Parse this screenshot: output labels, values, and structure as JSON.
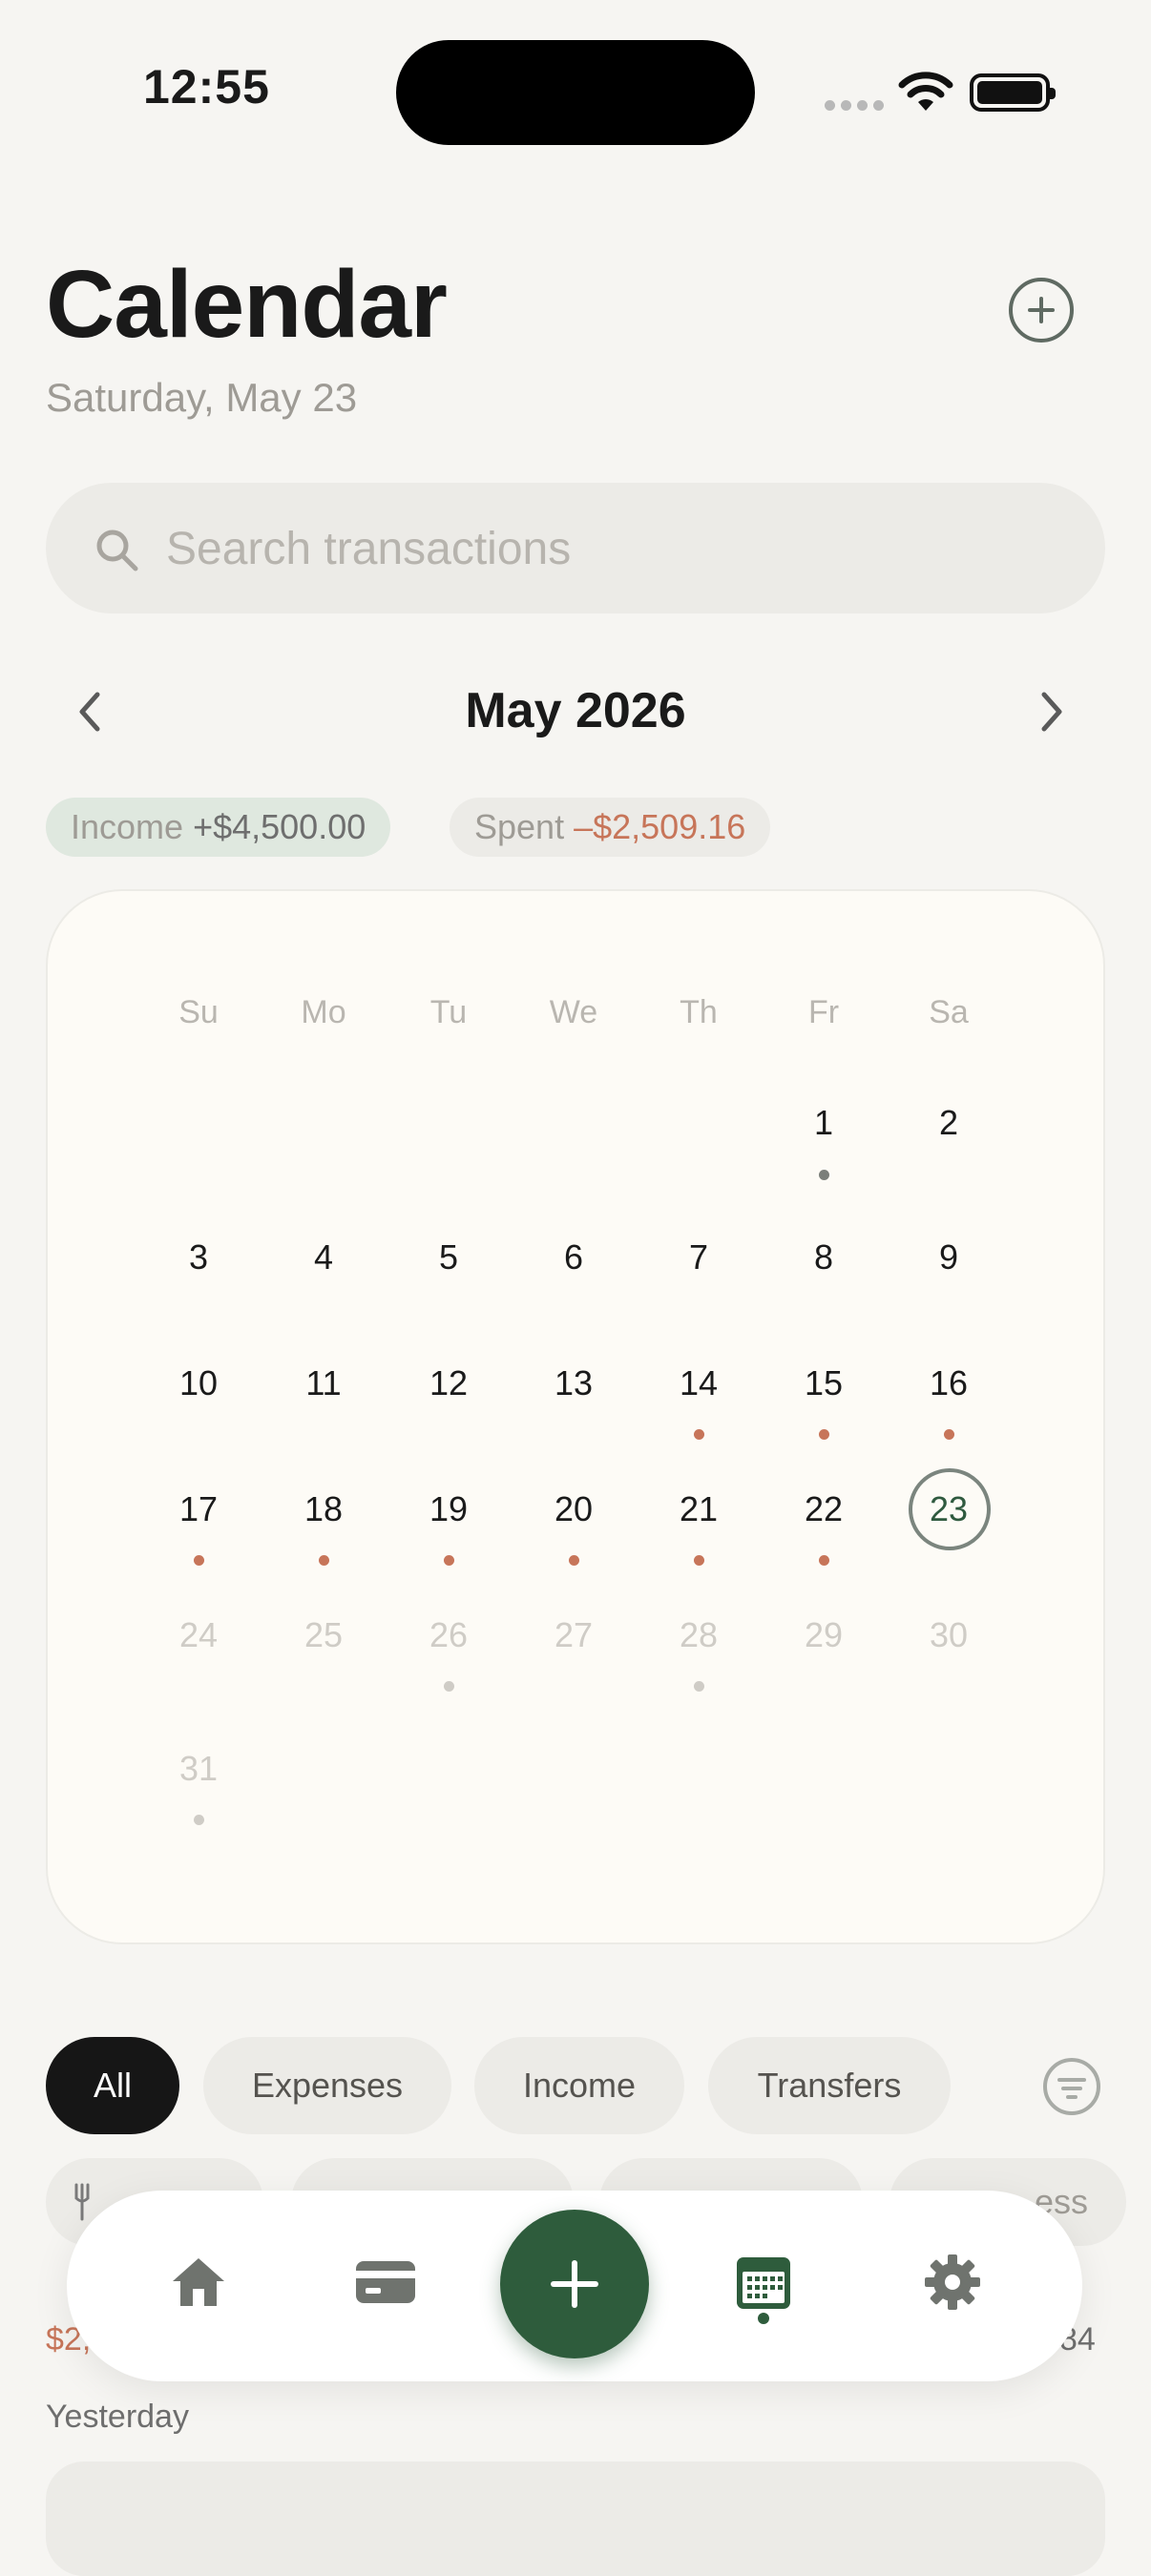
{
  "status_bar": {
    "time": "12:55"
  },
  "header": {
    "title": "Calendar",
    "subtitle": "Saturday, May 23"
  },
  "search": {
    "placeholder": "Search transactions"
  },
  "month_nav": {
    "label": "May 2026"
  },
  "summary": {
    "income_label": "Income",
    "income_value": "+$4,500.00",
    "spent_label": "Spent",
    "spent_value": "–$2,509.16"
  },
  "calendar": {
    "weekdays": [
      "Su",
      "Mo",
      "Tu",
      "We",
      "Th",
      "Fr",
      "Sa"
    ],
    "days": [
      "1",
      "2",
      "3",
      "4",
      "5",
      "6",
      "7",
      "8",
      "9",
      "10",
      "11",
      "12",
      "13",
      "14",
      "15",
      "16",
      "17",
      "18",
      "19",
      "20",
      "21",
      "22",
      "23",
      "24",
      "25",
      "26",
      "27",
      "28",
      "29",
      "30",
      "31"
    ],
    "today": "23"
  },
  "filters": {
    "all": "All",
    "expenses": "Expenses",
    "income": "Income",
    "transfers": "Transfers"
  },
  "categories_row": {
    "last_partial": "ess"
  },
  "list_peek": {
    "left_amount": "$2,",
    "right_amount": "84",
    "section": "Yesterday"
  },
  "colors": {
    "accent": "#2e5c3c",
    "spent": "#c77559",
    "income_bg": "#dfe8df"
  }
}
